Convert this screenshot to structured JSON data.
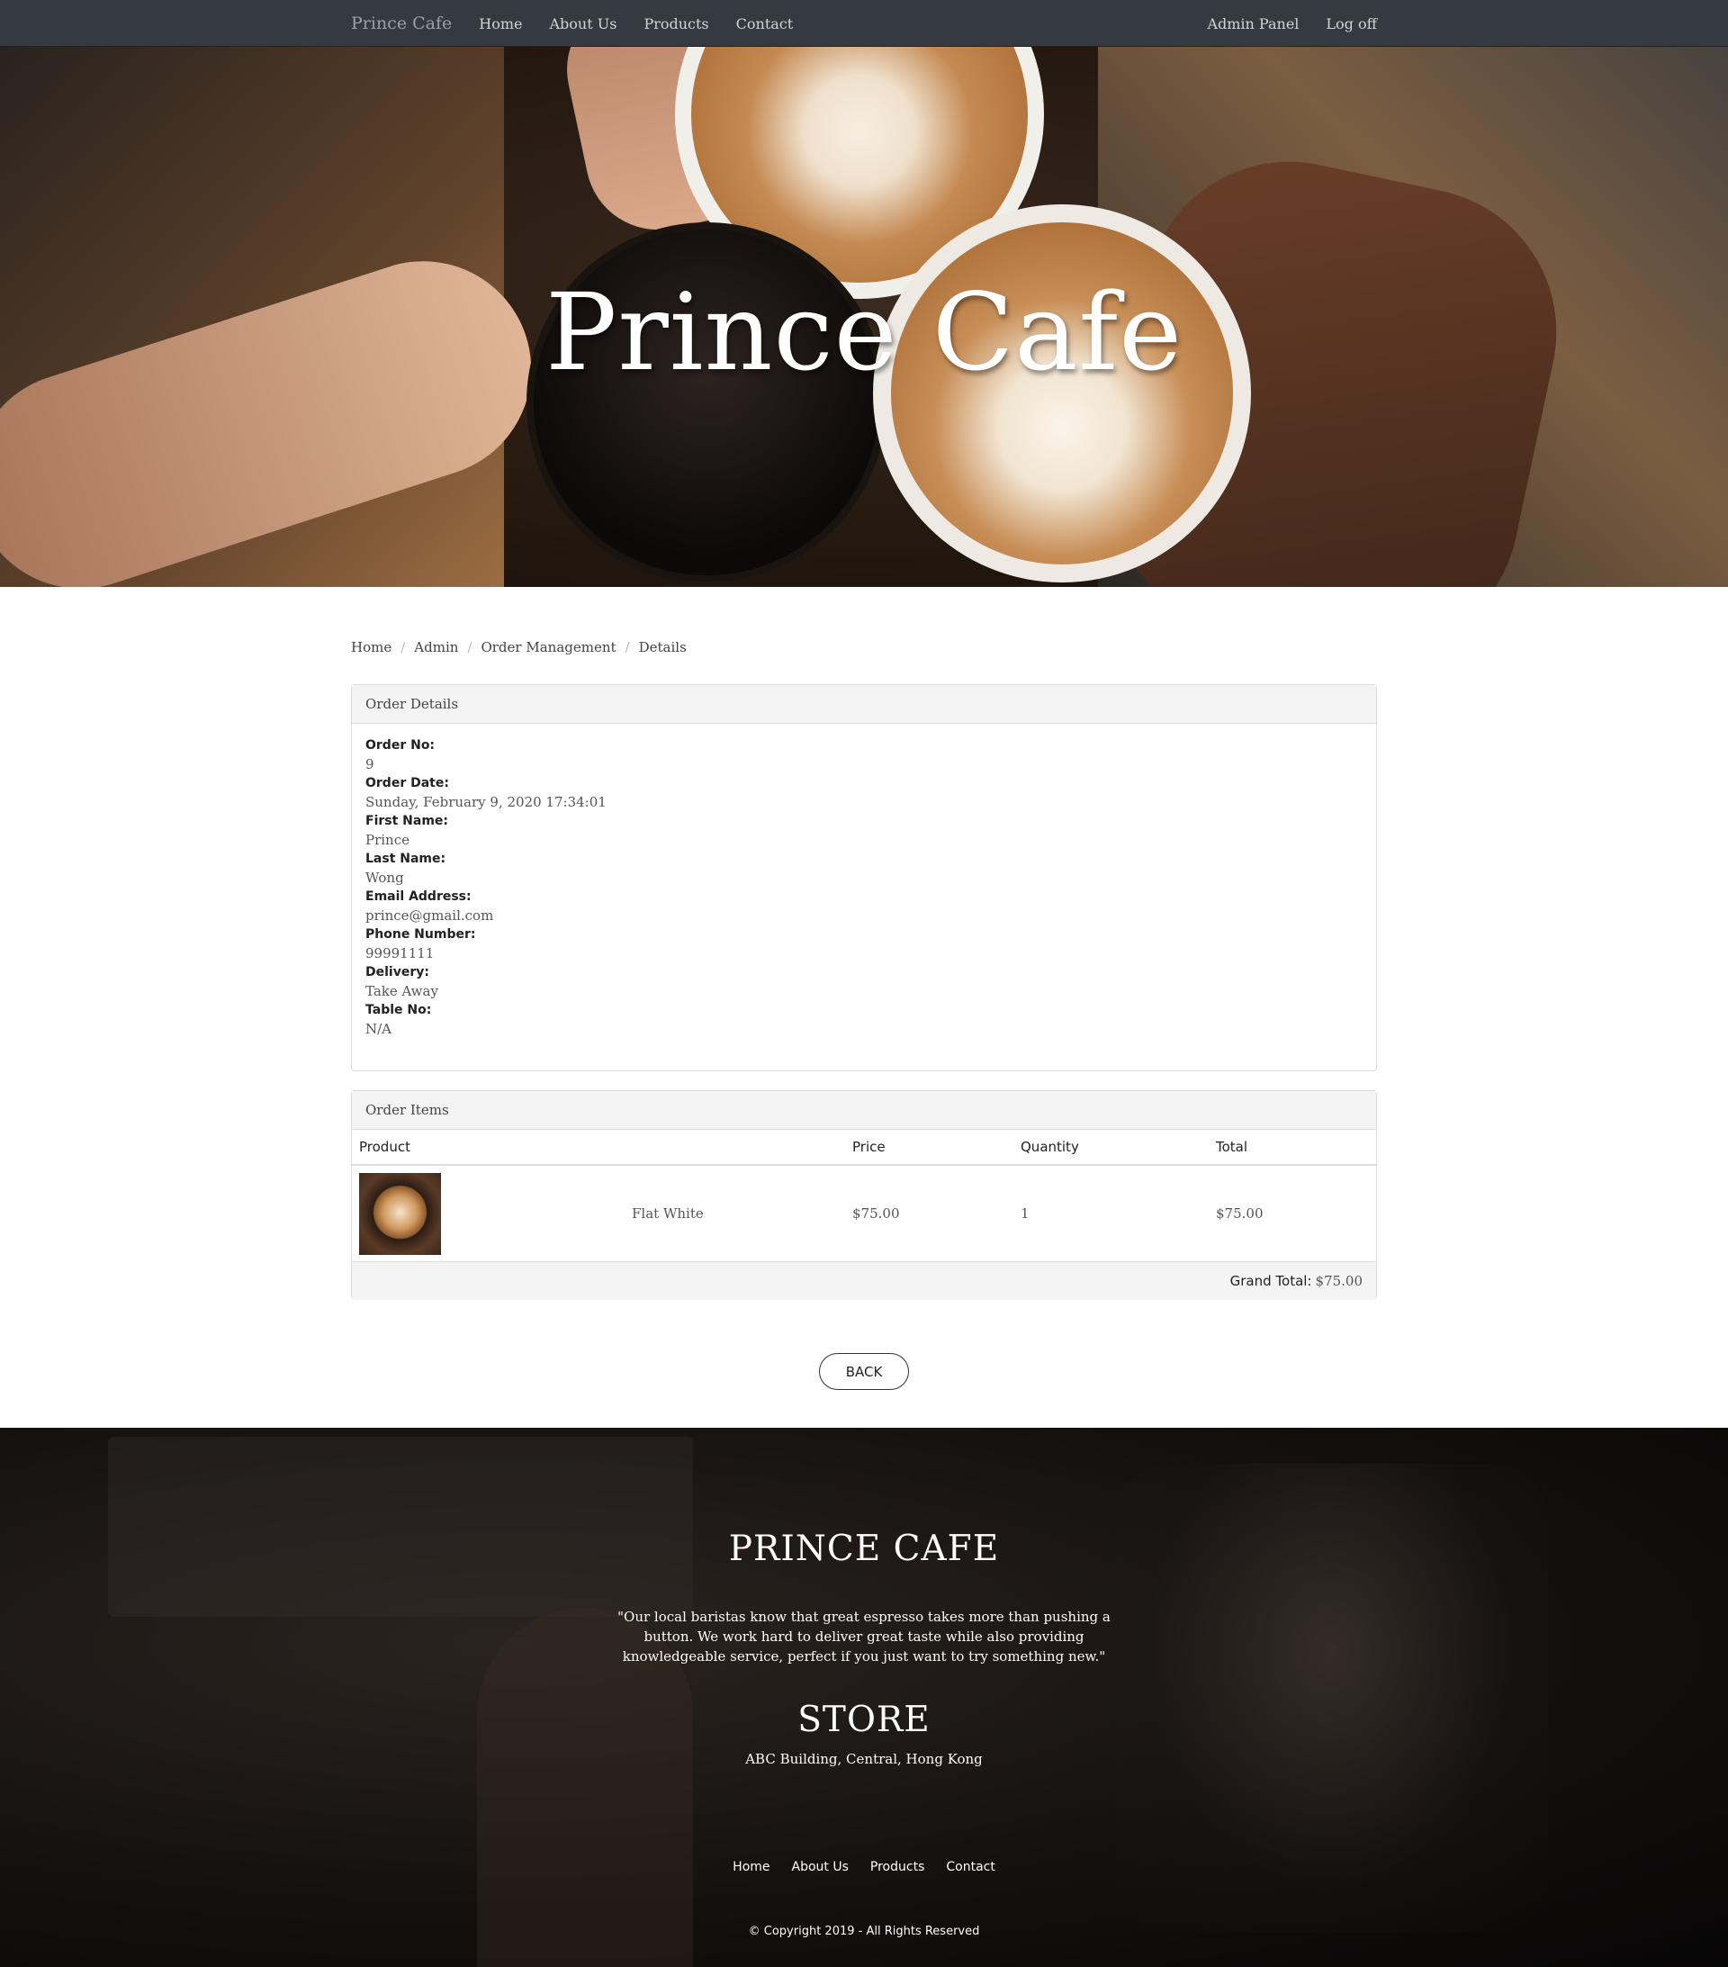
{
  "navbar": {
    "brand": "Prince Cafe",
    "links": [
      "Home",
      "About Us",
      "Products",
      "Contact"
    ],
    "right_links": [
      "Admin Panel",
      "Log off"
    ]
  },
  "hero": {
    "title": "Prince Cafe"
  },
  "breadcrumb": [
    "Home",
    "Admin",
    "Order Management",
    "Details"
  ],
  "order_details": {
    "header": "Order Details",
    "fields": [
      {
        "label": "Order No:",
        "value": "9"
      },
      {
        "label": "Order Date:",
        "value": "Sunday, February 9, 2020 17:34:01"
      },
      {
        "label": "First Name:",
        "value": "Prince"
      },
      {
        "label": "Last Name:",
        "value": "Wong"
      },
      {
        "label": "Email Address:",
        "value": "prince@gmail.com"
      },
      {
        "label": "Phone Number:",
        "value": "99991111"
      },
      {
        "label": "Delivery:",
        "value": "Take Away"
      },
      {
        "label": "Table No:",
        "value": "N/A"
      }
    ]
  },
  "order_items": {
    "header": "Order Items",
    "columns": [
      "Product",
      "",
      "Price",
      "Quantity",
      "Total"
    ],
    "rows": [
      {
        "name": "Flat White",
        "price": "$75.00",
        "quantity": "1",
        "total": "$75.00"
      }
    ],
    "grand_total_label": "Grand Total:",
    "grand_total_value": "$75.00"
  },
  "back_button": "BACK",
  "footer": {
    "title": "PRINCE CAFE",
    "quote": "\"Our local baristas know that great espresso takes more than pushing a button. We work hard to deliver great taste while also providing knowledgeable service, perfect if you just want to try something new.\"",
    "store_title": "STORE",
    "address": "ABC Building, Central, Hong Kong",
    "links": [
      "Home",
      "About Us",
      "Products",
      "Contact"
    ],
    "copyright": "© Copyright 2019 - All Rights Reserved"
  }
}
